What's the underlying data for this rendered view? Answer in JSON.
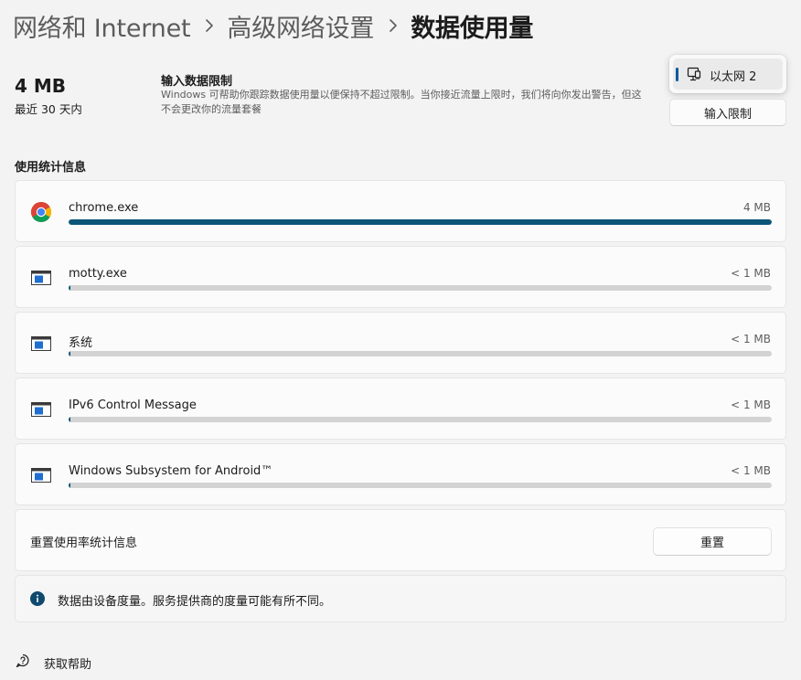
{
  "breadcrumb": {
    "items": [
      "网络和 Internet",
      "高级网络设置"
    ],
    "current": "数据使用量"
  },
  "summary": {
    "amount": "4 MB",
    "period": "最近 30 天内"
  },
  "limit": {
    "title": "输入数据限制",
    "description": "Windows 可帮助你跟踪数据使用量以便保持不超过限制。当你接近流量上限时，我们将向你发出警告，但这不会更改你的流量套餐",
    "button_label": "输入限制"
  },
  "network_selector": {
    "selected": "以太网 2"
  },
  "usage": {
    "heading": "使用统计信息",
    "apps": [
      {
        "name": "chrome.exe",
        "amount": "4 MB",
        "share": 1.0
      },
      {
        "name": "motty.exe",
        "amount": "< 1 MB",
        "share": 0.002
      },
      {
        "name": "系统",
        "amount": "< 1 MB",
        "share": 0.002
      },
      {
        "name": "IPv6 Control Message",
        "amount": "< 1 MB",
        "share": 0.002
      },
      {
        "name": "Windows Subsystem for Android™",
        "amount": "< 1 MB",
        "share": 0.002
      }
    ]
  },
  "reset": {
    "label": "重置使用率统计信息",
    "button_label": "重置"
  },
  "info": {
    "text": "数据由设备度量。服务提供商的度量可能有所不同。"
  },
  "help": {
    "label": "获取帮助"
  },
  "colors": {
    "accent": "#005a9e",
    "bar_fill": "#0b5676",
    "bar_track": "#d3d3d3",
    "background": "#f3f3f3"
  }
}
